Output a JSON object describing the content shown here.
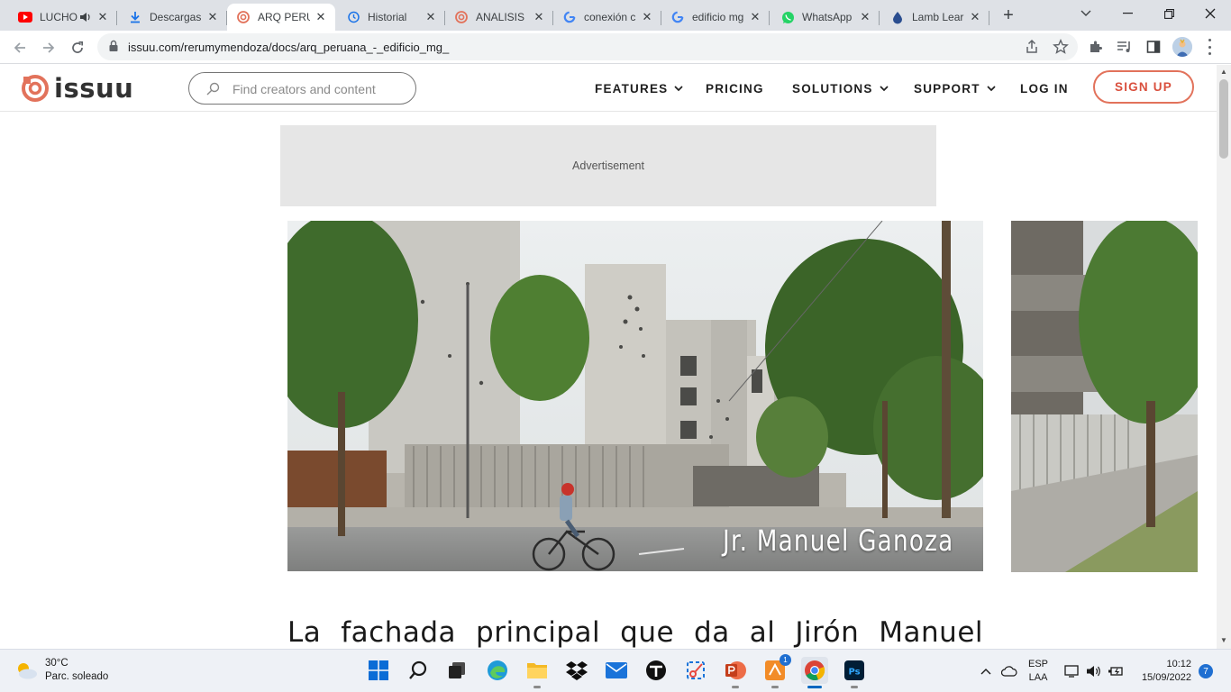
{
  "browser": {
    "tabs": [
      {
        "title": "LUCHO",
        "icon": "youtube-icon",
        "audio": true
      },
      {
        "title": "Descargas",
        "icon": "download-icon"
      },
      {
        "title": "ARQ PERU",
        "icon": "issuu-icon",
        "active": true
      },
      {
        "title": "Historial",
        "icon": "history-icon"
      },
      {
        "title": "ANALISIS I",
        "icon": "issuu-icon"
      },
      {
        "title": "conexión c",
        "icon": "google-icon"
      },
      {
        "title": "edificio mg",
        "icon": "google-icon"
      },
      {
        "title": "WhatsApp",
        "icon": "whatsapp-icon"
      },
      {
        "title": "Lamb Lear",
        "icon": "drop-icon"
      }
    ],
    "url": "issuu.com/rerumymendoza/docs/arq_peruana_-_edificio_mg_"
  },
  "site": {
    "logo_text": "issuu",
    "search_placeholder": "Find creators and content",
    "nav": {
      "features": "FEATURES",
      "pricing": "PRICING",
      "solutions": "SOLUTIONS",
      "support": "SUPPORT",
      "login": "LOG IN",
      "signup": "SIGN UP"
    },
    "brand_color": "#e2725b"
  },
  "document": {
    "ad_label": "Advertisement",
    "photo_caption": "Jr. Manuel Ganoza",
    "body_text": "La fachada principal que da al Jirón Manuel"
  },
  "taskbar": {
    "weather_temp": "30°C",
    "weather_desc": "Parc. soleado",
    "apps": [
      "start-icon",
      "search-icon",
      "task-view-icon",
      "edge-icon",
      "file-explorer-icon",
      "dropbox-icon",
      "mail-icon",
      "tidal-icon",
      "snipping-tool-icon",
      "powerpoint-icon",
      "app-badge-icon",
      "chrome-icon",
      "photoshop-icon"
    ],
    "app_badge_count": "1",
    "lang_line1": "ESP",
    "lang_line2": "LAA",
    "time": "10:12",
    "date": "15/09/2022",
    "notifications": "7"
  }
}
